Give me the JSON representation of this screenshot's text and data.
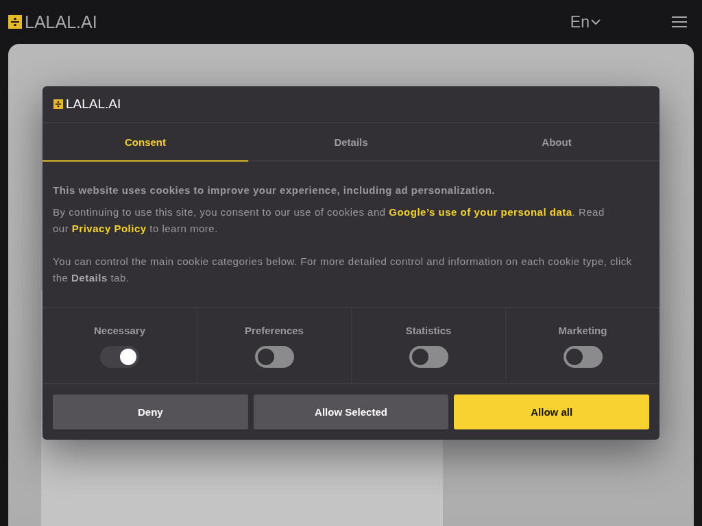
{
  "header": {
    "logo": "LALAL.AI",
    "language": "En"
  },
  "dialog": {
    "logo": "LALAL.AI",
    "tabs": [
      {
        "label": "Consent",
        "selected": true
      },
      {
        "label": "Details",
        "selected": false
      },
      {
        "label": "About",
        "selected": false
      }
    ],
    "intro": "This website uses cookies to improve your experience, including ad personalization.",
    "paragraph_1": "By continuing to use this site, you consent to our use of cookies and **Google’s use of your personal data**. Read our **Privacy Policy** to learn more.",
    "paragraph_2": "You can control the main cookie categories below. For more detailed control and information on each cookie type, click the **Details** tab.",
    "categories": [
      {
        "label": "Necessary",
        "on": true
      },
      {
        "label": "Preferences",
        "on": false
      },
      {
        "label": "Statistics",
        "on": false
      },
      {
        "label": "Marketing",
        "on": false
      }
    ],
    "buttons": [
      {
        "label": "Deny",
        "kind": "secondary"
      },
      {
        "label": "Allow Selected",
        "kind": "secondary"
      },
      {
        "label": "Allow all",
        "kind": "primary"
      }
    ]
  }
}
